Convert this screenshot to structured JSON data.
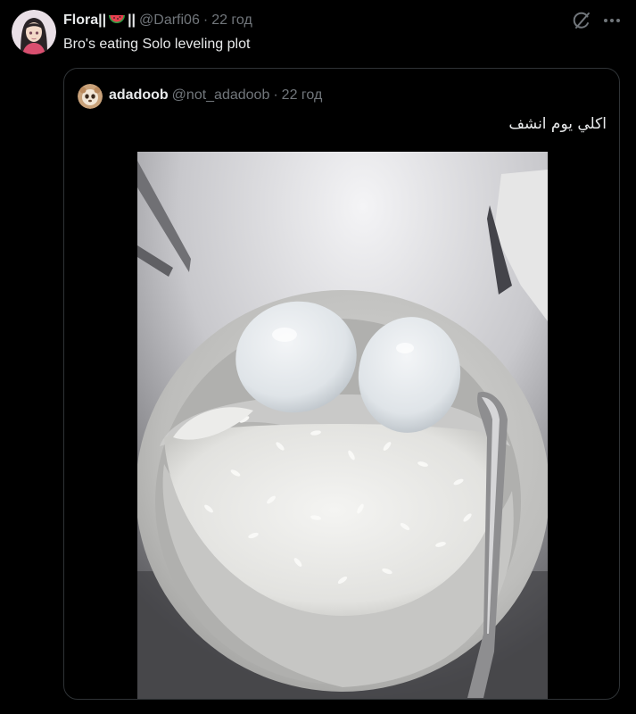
{
  "tweet": {
    "author_name": "Flora||",
    "author_name_suffix": "||",
    "author_emoji": "watermelon",
    "handle": "@Darfi06",
    "separator": "·",
    "time": "22 год",
    "text": "Bro's eating Solo leveling plot"
  },
  "quoted_tweet": {
    "author_name": "adadoob",
    "handle": "@not_adadoob",
    "separator": "·",
    "time": "22 год",
    "text": "اكلي يوم انشف",
    "media": "photo-bowl-rice-two-boiled-eggs"
  },
  "icons": {
    "grok": "grok-icon",
    "more": "more-icon"
  },
  "colors": {
    "background": "#000000",
    "text": "#e7e9ea",
    "secondary": "#71767b",
    "border": "#2f3336"
  }
}
